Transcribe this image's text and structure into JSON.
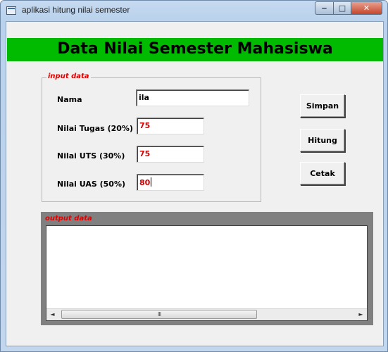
{
  "window": {
    "title": "aplikasi hitung nilai semester",
    "controls": {
      "minimize": "‒",
      "maximize": "□",
      "close": "✕"
    }
  },
  "header": {
    "title": "Data Nilai Semester Mahasiswa"
  },
  "input_group": {
    "legend": "input data",
    "fields": [
      {
        "label": "Nama",
        "value": "ila"
      },
      {
        "label": "Nilai Tugas (20%)",
        "value": "75"
      },
      {
        "label": "Nilai UTS (30%)",
        "value": "75"
      },
      {
        "label": "Nilai UAS (50%)",
        "value": "80"
      }
    ]
  },
  "buttons": {
    "simpan": "Simpan",
    "hitung": "Hitung",
    "cetak": "Cetak"
  },
  "output_group": {
    "legend": "output data",
    "content": "",
    "scroll": {
      "left": "◄",
      "right": "►",
      "thumb_grip": "III"
    }
  },
  "colors": {
    "header_bg": "#00bb00",
    "legend": "#e00000",
    "numeric_text": "#d00000"
  }
}
